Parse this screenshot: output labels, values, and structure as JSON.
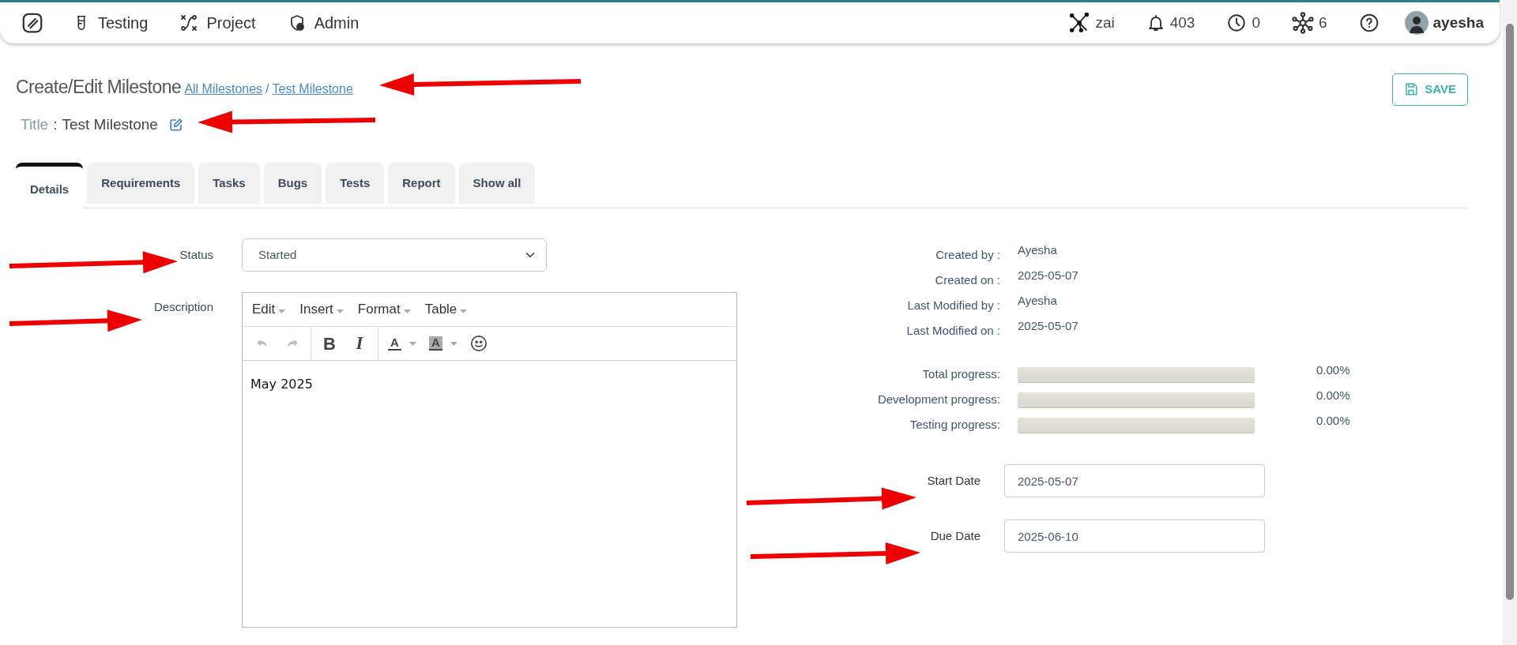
{
  "navbar": {
    "items": [
      {
        "kind": "logo"
      },
      {
        "kind": "flask",
        "label": "Testing"
      },
      {
        "kind": "flow",
        "label": "Project"
      },
      {
        "kind": "shield",
        "label": "Admin"
      }
    ],
    "right": [
      {
        "kind": "ai",
        "label": "zai"
      },
      {
        "kind": "bell",
        "label": "403"
      },
      {
        "kind": "clock",
        "label": "0"
      },
      {
        "kind": "network",
        "label": "6"
      },
      {
        "kind": "help"
      },
      {
        "kind": "user",
        "label": "ayesha"
      }
    ]
  },
  "header": {
    "heading": "Create/Edit Milestone",
    "breadcrumbs": [
      {
        "label": "All Milestones"
      },
      {
        "label": "/",
        "kind": "separator"
      },
      {
        "label": "Test Milestone"
      }
    ],
    "title_label": "Title",
    "title_separator": ":",
    "title_value": "Test Milestone",
    "save_button": "SAVE"
  },
  "tabs": [
    {
      "label": "Details",
      "selected": true
    },
    {
      "label": "Requirements",
      "selected": false
    },
    {
      "label": "Tasks",
      "selected": false
    },
    {
      "label": "Bugs",
      "selected": false
    },
    {
      "label": "Tests",
      "selected": false
    },
    {
      "label": "Report",
      "selected": false
    },
    {
      "label": "Show all",
      "selected": false
    }
  ],
  "form": {
    "status": {
      "label": "Status",
      "value": "Started"
    },
    "description": {
      "label": "Description",
      "menus": [
        "Edit",
        "Insert",
        "Format",
        "Table"
      ],
      "toolbar": [
        {
          "kind": "undo",
          "disabled": true
        },
        {
          "kind": "redo",
          "disabled": true
        },
        {
          "kind": "separator"
        },
        {
          "kind": "bold",
          "glyph": "B",
          "disabled": false
        },
        {
          "kind": "italic",
          "glyph": "I",
          "disabled": false
        },
        {
          "kind": "separator"
        },
        {
          "kind": "forecolor",
          "glyph": "A",
          "disabled": false
        },
        {
          "kind": "backcolor",
          "glyph": "A",
          "disabled": false
        },
        {
          "kind": "emoji",
          "disabled": false
        }
      ],
      "content": "May 2025"
    }
  },
  "details": [
    {
      "label": "Created by :",
      "value": "Ayesha"
    },
    {
      "label": "Created on :",
      "value": "2025-05-07"
    },
    {
      "label": "Last Modified by :",
      "value": "Ayesha"
    },
    {
      "label": "Last Modified on :",
      "value": "2025-05-07"
    }
  ],
  "progress": [
    {
      "label": "Total progress:",
      "level": 0,
      "reading": "0.00%"
    },
    {
      "label": "Development progress:",
      "level": 0,
      "reading": "0.00%"
    },
    {
      "label": "Testing progress:",
      "level": 0,
      "reading": "0.00%"
    }
  ],
  "dates": [
    {
      "label": "Start Date",
      "value": "2025-05-07"
    },
    {
      "label": "Due Date",
      "value": "2025-06-10"
    }
  ]
}
